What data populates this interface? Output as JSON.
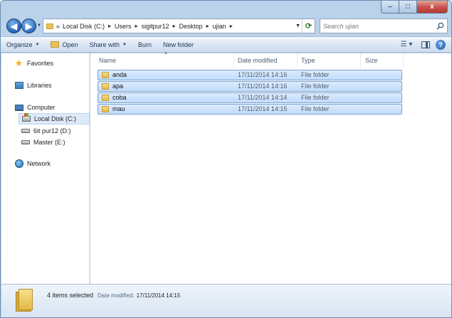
{
  "window": {
    "controls": {
      "minimize": "–",
      "maximize": "□",
      "close": "x"
    }
  },
  "nav": {
    "back_symbol": "◀",
    "forward_symbol": "▶",
    "address": {
      "lead": "«",
      "crumbs": [
        "Local Disk (C:)",
        "Users",
        "sigitpur12",
        "Desktop",
        "ujian"
      ]
    },
    "search_placeholder": "Search ujian"
  },
  "toolbar": {
    "organize": "Organize",
    "open": "Open",
    "share_with": "Share with",
    "burn": "Burn",
    "new_folder": "New folder",
    "help": "?"
  },
  "sidebar": {
    "favorites": "Favorites",
    "libraries": "Libraries",
    "computer": "Computer",
    "drives": [
      "Local Disk (C:)",
      "6it pur12 (D:)",
      "Master (E:)"
    ],
    "network": "Network"
  },
  "columns": {
    "name": "Name",
    "date": "Date modified",
    "type": "Type",
    "size": "Size"
  },
  "files": [
    {
      "name": "anda",
      "date": "17/11/2014 14:16",
      "type": "File folder"
    },
    {
      "name": "apa",
      "date": "17/11/2014 14:16",
      "type": "File folder"
    },
    {
      "name": "coba",
      "date": "17/11/2014 14:14",
      "type": "File folder"
    },
    {
      "name": "mau",
      "date": "17/11/2014 14:15",
      "type": "File folder"
    }
  ],
  "details": {
    "count": "4 items selected",
    "label": "Date modified:",
    "value": "17/11/2014 14:15"
  },
  "colors": {
    "selection": "#c1dcfc",
    "selection_border": "#7da2ce",
    "chrome": "#bdd3ea"
  }
}
